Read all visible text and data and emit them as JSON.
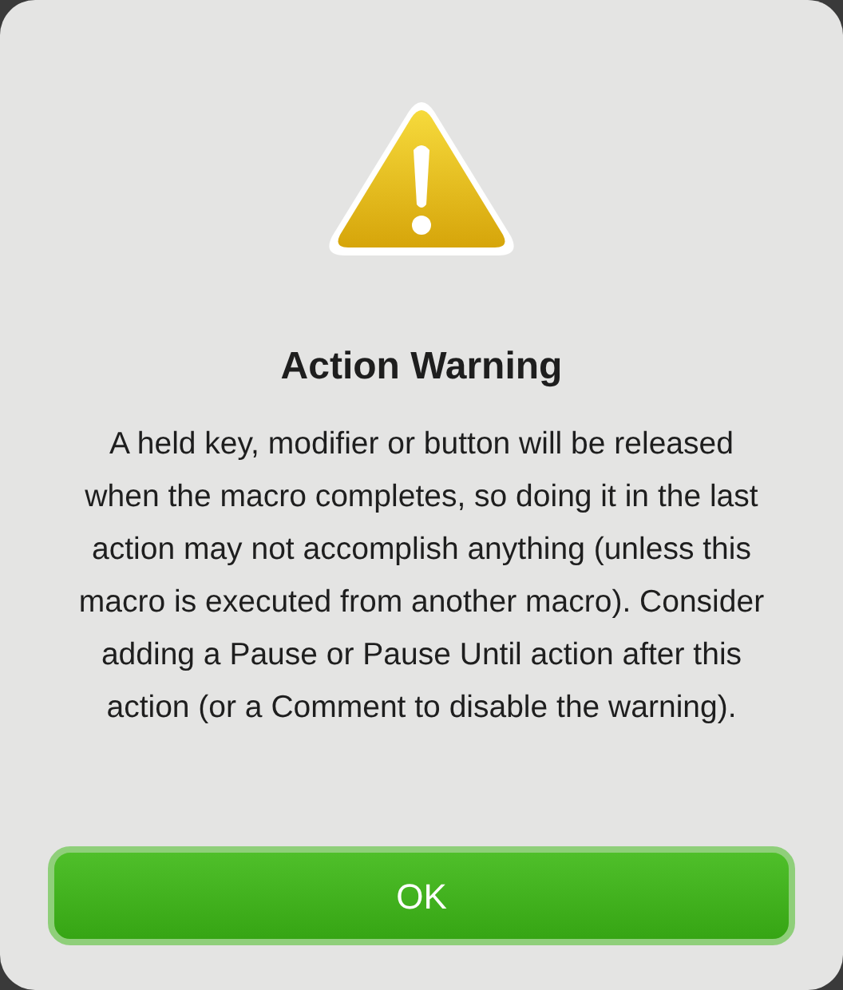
{
  "dialog": {
    "title": "Action Warning",
    "message": "A held key, modifier or button will be released when the macro completes, so doing it in the last action may not accomplish anything (unless this macro is executed from another macro). Consider adding a Pause or Pause Until action after this action (or a Comment to disable the warning).",
    "buttons": [
      {
        "label": "OK",
        "kind": "default"
      }
    ]
  }
}
